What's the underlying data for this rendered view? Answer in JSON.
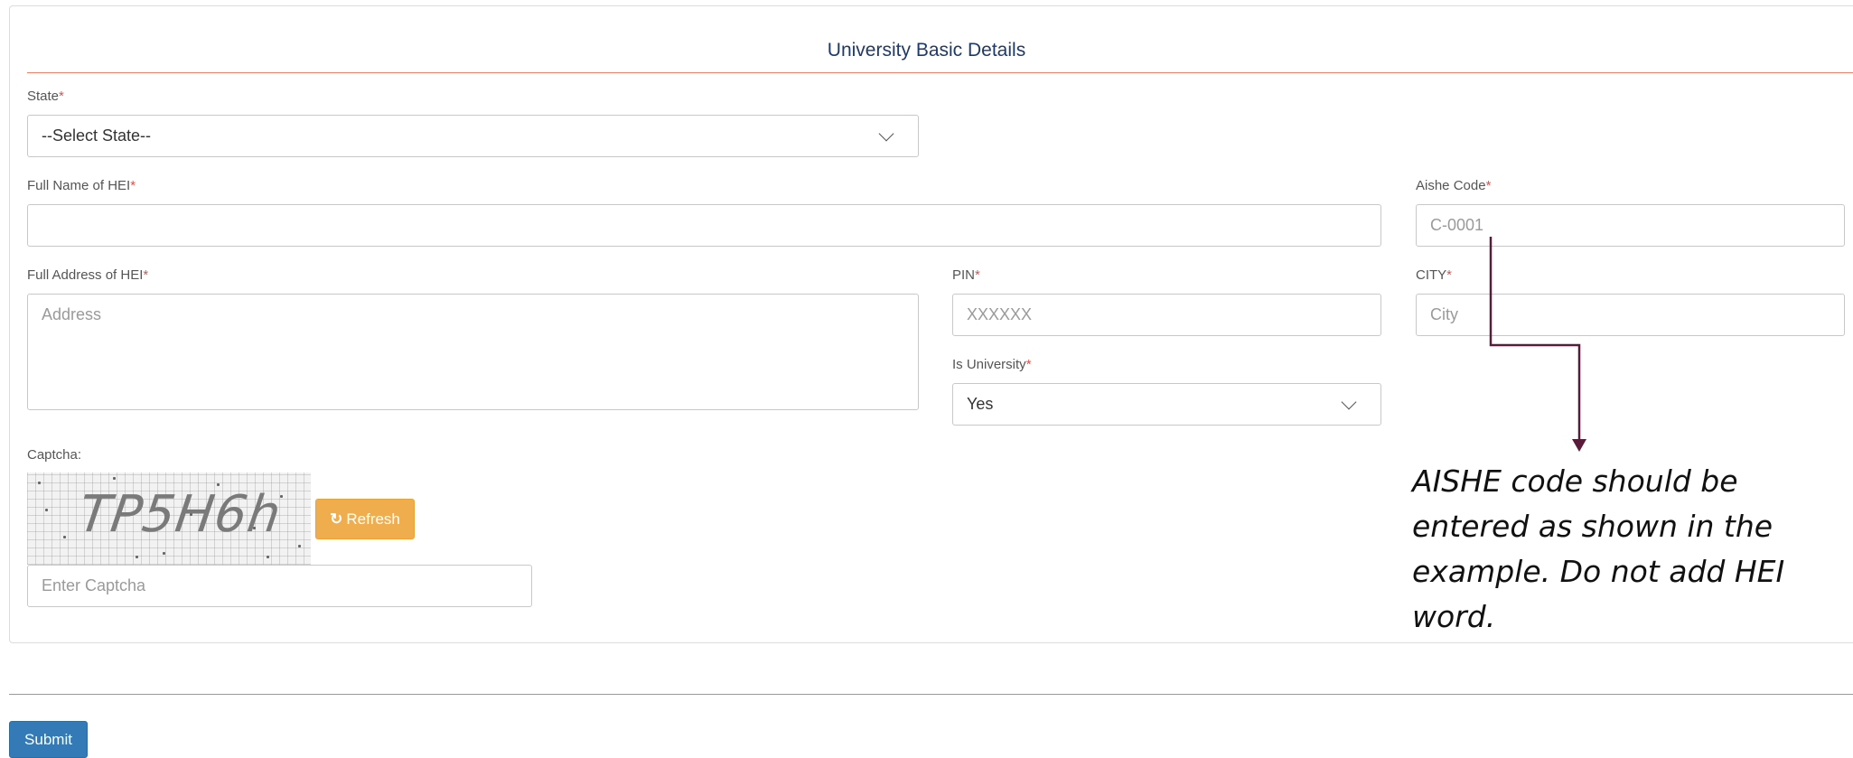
{
  "form": {
    "title": "University Basic Details",
    "state": {
      "label": "State",
      "required_mark": "*",
      "selected": "--Select State--"
    },
    "hei_name": {
      "label": "Full Name of HEI",
      "required_mark": "*",
      "value": ""
    },
    "aishe_code": {
      "label": "Aishe Code",
      "required_mark": "*",
      "placeholder": "C-0001"
    },
    "address": {
      "label": "Full Address of HEI",
      "required_mark": "*",
      "placeholder": "Address"
    },
    "pin": {
      "label": "PIN",
      "required_mark": "*",
      "placeholder": "XXXXXX"
    },
    "city": {
      "label": "CITY",
      "required_mark": "*",
      "placeholder": "City"
    },
    "is_university": {
      "label": "Is University",
      "required_mark": "*",
      "selected": "Yes"
    },
    "captcha": {
      "label": "Captcha:",
      "image_text": "TP5H6h",
      "refresh_label": "Refresh",
      "input_placeholder": "Enter Captcha"
    }
  },
  "annotation": {
    "text": "AISHE code should be entered as shown in the example. Do not add HEI word."
  },
  "actions": {
    "submit_label": "Submit"
  },
  "colors": {
    "accent_rule": "#e8806a",
    "title": "#1f3a68",
    "required": "#d9534f",
    "refresh_button": "#f0ad4e",
    "submit_button": "#337ab7",
    "arrow": "#5a1a3a"
  },
  "icons": {
    "select_chevron": "chevron-down-icon",
    "refresh": "refresh-icon"
  }
}
